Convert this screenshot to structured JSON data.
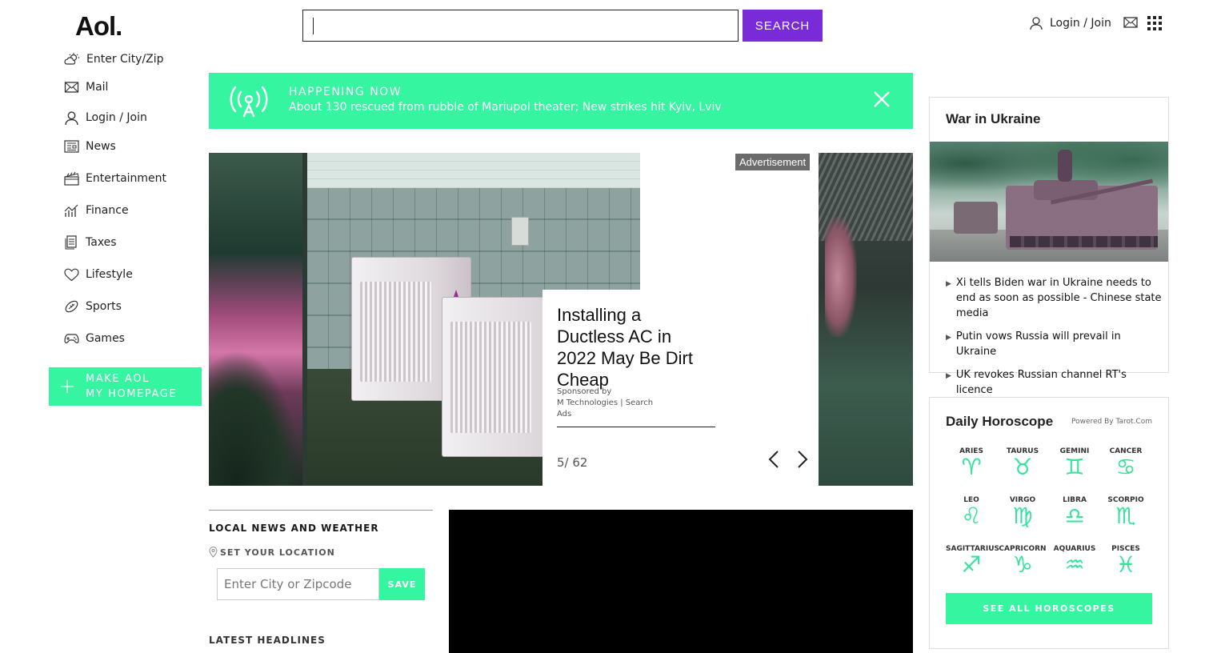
{
  "header": {
    "logo": "Aol.",
    "search_button": "SEARCH",
    "login": "Login / Join"
  },
  "sidebar": {
    "items": [
      {
        "label": "Enter City/Zip",
        "icon": "weather-icon"
      },
      {
        "label": "Mail",
        "icon": "mail-icon"
      },
      {
        "label": "Login / Join",
        "icon": "user-icon"
      },
      {
        "label": "News",
        "icon": "news-icon"
      },
      {
        "label": "Entertainment",
        "icon": "clapperboard-icon"
      },
      {
        "label": "Finance",
        "icon": "chart-icon"
      },
      {
        "label": "Taxes",
        "icon": "documents-icon"
      },
      {
        "label": "Lifestyle",
        "icon": "heart-icon"
      },
      {
        "label": "Sports",
        "icon": "football-icon"
      },
      {
        "label": "Games",
        "icon": "gamepad-icon"
      }
    ],
    "homepage_line1": "MAKE AOL",
    "homepage_line2": "MY HOMEPAGE"
  },
  "banner": {
    "label": "HAPPENING NOW",
    "headline": "About 130 rescued from rubble of Mariupol theater; New strikes hit Kyiv, Lviv"
  },
  "carousel": {
    "ad_label": "Advertisement",
    "title": "Installing a Ductless AC in 2022 May Be Dirt Cheap",
    "sponsored_by": "Sponsored by",
    "sponsor": "M Technologies | Search Ads",
    "counter": "5/ 62"
  },
  "local": {
    "title": "LOCAL NEWS AND WEATHER",
    "set_location": "SET YOUR LOCATION",
    "zip_placeholder": "Enter City or Zipcode",
    "save": "SAVE",
    "latest": "LATEST HEADLINES"
  },
  "war": {
    "title": "War in Ukraine",
    "items": [
      "Xi tells Biden war in Ukraine needs to end as soon as possible - Chinese state media",
      "Putin vows Russia will prevail in Ukraine",
      "UK revokes Russian channel RT's licence"
    ]
  },
  "horoscope": {
    "title": "Daily Horoscope",
    "powered": "Powered By Tarot.Com",
    "signs": [
      {
        "name": "ARIES",
        "glyph": "♈"
      },
      {
        "name": "TAURUS",
        "glyph": "♉"
      },
      {
        "name": "GEMINI",
        "glyph": "♊"
      },
      {
        "name": "CANCER",
        "glyph": "♋"
      },
      {
        "name": "LEO",
        "glyph": "♌"
      },
      {
        "name": "VIRGO",
        "glyph": "♍"
      },
      {
        "name": "LIBRA",
        "glyph": "♎"
      },
      {
        "name": "SCORPIO",
        "glyph": "♏"
      },
      {
        "name": "SAGITTARIUS",
        "glyph": "♐"
      },
      {
        "name": "CAPRICORN",
        "glyph": "♑"
      },
      {
        "name": "AQUARIUS",
        "glyph": "♒"
      },
      {
        "name": "PISCES",
        "glyph": "♓"
      }
    ],
    "see_all": "SEE ALL HOROSCOPES"
  },
  "colors": {
    "accent_green": "#35f5a0",
    "search_purple": "#7a2bd8"
  }
}
